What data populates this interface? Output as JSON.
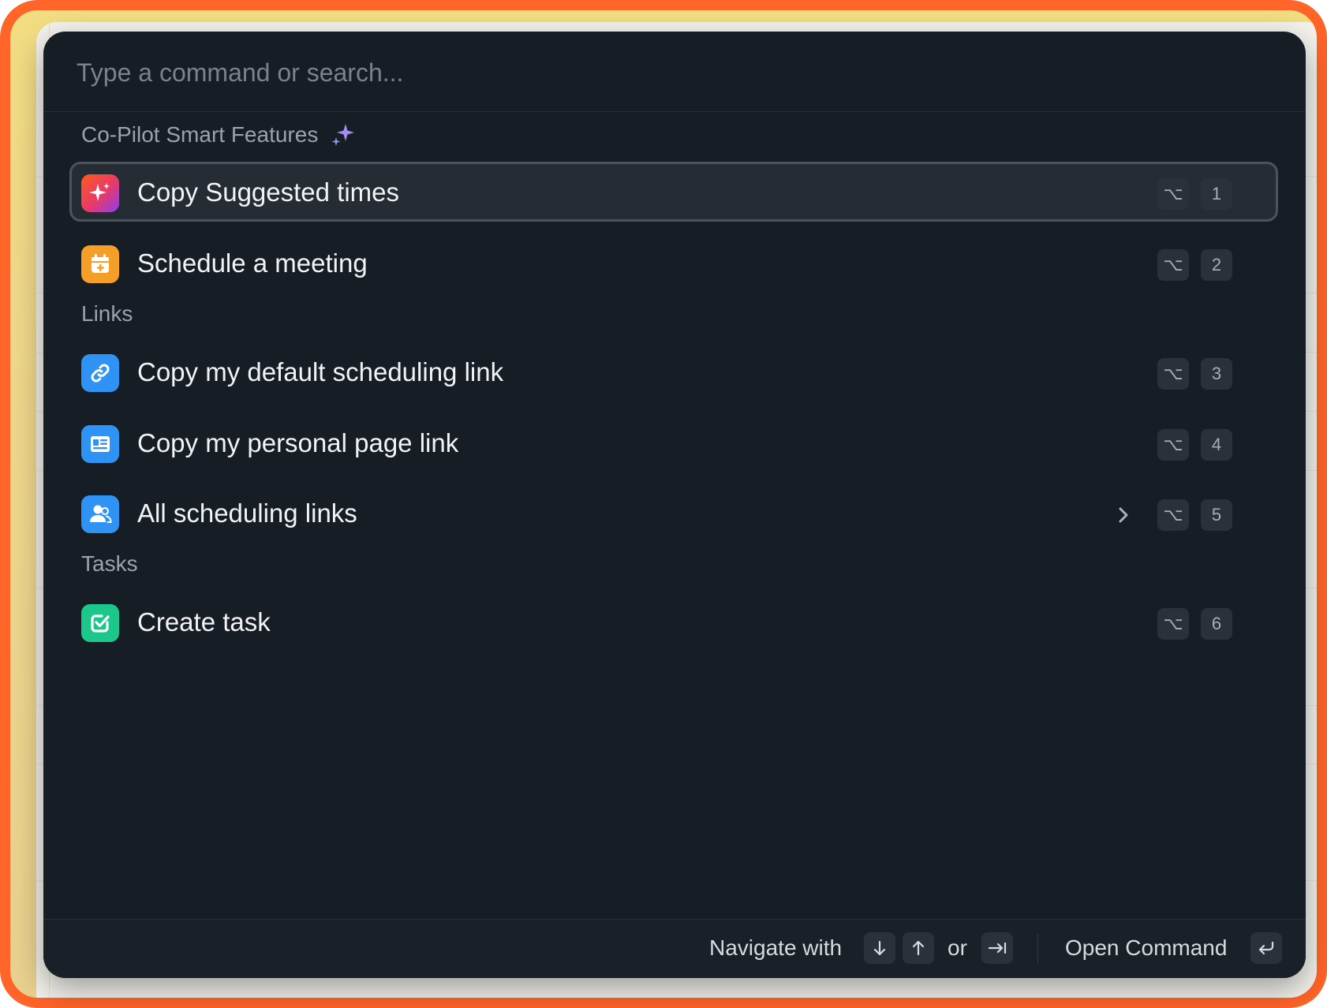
{
  "search": {
    "placeholder": "Type a command or search..."
  },
  "sections": {
    "copilot": "Co-Pilot Smart Features",
    "links": "Links",
    "tasks": "Tasks"
  },
  "items": [
    {
      "label": "Copy Suggested times",
      "icon": "sparkle-icon",
      "color": "#f0532e",
      "option_key": "⌥",
      "number_key": "1",
      "selected": true
    },
    {
      "label": "Schedule a meeting",
      "icon": "calendar-plus-icon",
      "color": "#f59f28",
      "option_key": "⌥",
      "number_key": "2"
    },
    {
      "label": "Copy my default scheduling link",
      "icon": "link-icon",
      "color": "#2f93f5",
      "option_key": "⌥",
      "number_key": "3"
    },
    {
      "label": "Copy my personal page link",
      "icon": "page-icon",
      "color": "#2f93f5",
      "option_key": "⌥",
      "number_key": "4"
    },
    {
      "label": "All scheduling links",
      "icon": "users-icon",
      "color": "#2f93f5",
      "option_key": "⌥",
      "number_key": "5",
      "has_submenu": true
    },
    {
      "label": "Create task",
      "icon": "checkbox-icon",
      "color": "#1cc78b",
      "option_key": "⌥",
      "number_key": "6"
    }
  ],
  "footer": {
    "navigate_label": "Navigate with",
    "or_label": "or",
    "open_label": "Open Command",
    "keys": [
      "arrow-down-icon",
      "arrow-up-icon",
      "tab-icon",
      "return-icon"
    ]
  },
  "colors": {
    "accent_sparkle": "#a48cf5",
    "panel_bg": "#171d24",
    "frame": "#ff6428"
  }
}
